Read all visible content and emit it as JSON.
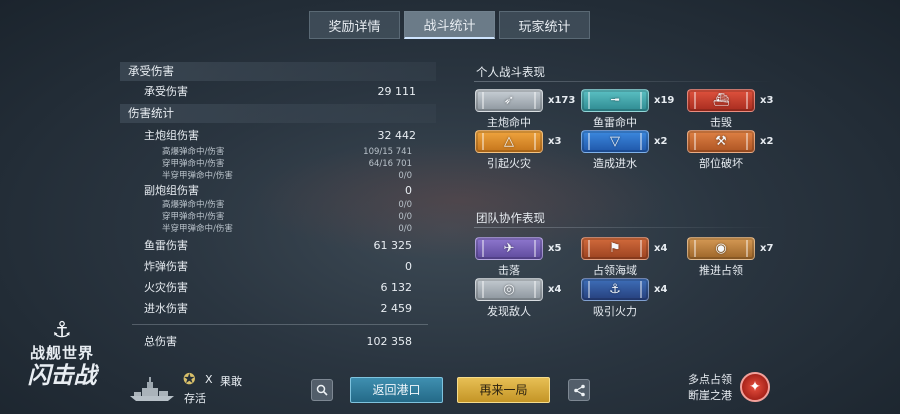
{
  "tabs": [
    {
      "label": "奖励详情",
      "active": false
    },
    {
      "label": "战斗统计",
      "active": true
    },
    {
      "label": "玩家统计",
      "active": false
    }
  ],
  "damage_taken": {
    "header": "承受伤害",
    "rows": [
      {
        "label": "承受伤害",
        "value": "29 111"
      }
    ]
  },
  "damage_stats": {
    "header": "伤害统计",
    "main_battery": {
      "label": "主炮组伤害",
      "value": "32 442"
    },
    "main_sub": [
      {
        "label": "高爆弹命中/伤害",
        "value": "109/15 741"
      },
      {
        "label": "穿甲弹命中/伤害",
        "value": "64/16 701"
      },
      {
        "label": "半穿甲弹命中/伤害",
        "value": "0/0"
      }
    ],
    "secondary": {
      "label": "副炮组伤害",
      "value": "0"
    },
    "secondary_sub": [
      {
        "label": "高爆弹命中/伤害",
        "value": "0/0"
      },
      {
        "label": "穿甲弹命中/伤害",
        "value": "0/0"
      },
      {
        "label": "半穿甲弹命中/伤害",
        "value": "0/0"
      }
    ],
    "others": [
      {
        "label": "鱼雷伤害",
        "value": "61 325"
      },
      {
        "label": "炸弹伤害",
        "value": "0"
      },
      {
        "label": "火灾伤害",
        "value": "6 132"
      },
      {
        "label": "进水伤害",
        "value": "2 459"
      }
    ],
    "total": {
      "label": "总伤害",
      "value": "102 358"
    }
  },
  "personal": {
    "title": "个人战斗表现",
    "medals": [
      {
        "label": "主炮命中",
        "count": "x173",
        "color": "#c9d0d6",
        "icon": "shell-icon"
      },
      {
        "label": "鱼雷命中",
        "count": "x19",
        "color": "#5cc1c4",
        "icon": "torpedo-icon"
      },
      {
        "label": "击毁",
        "count": "x3",
        "color": "#e0533e",
        "icon": "sinking-ship-icon"
      },
      {
        "label": "引起火灾",
        "count": "x3",
        "color": "#f0a53f",
        "icon": "fire-icon"
      },
      {
        "label": "造成进水",
        "count": "x2",
        "color": "#3d8ae0",
        "icon": "flooding-icon"
      },
      {
        "label": "部位破坏",
        "count": "x2",
        "color": "#e08245",
        "icon": "module-break-icon"
      }
    ]
  },
  "team": {
    "title": "团队协作表现",
    "medals": [
      {
        "label": "击落",
        "count": "x5",
        "color": "#8f78cf",
        "icon": "plane-shot-icon"
      },
      {
        "label": "占领海域",
        "count": "x4",
        "color": "#d26b3c",
        "icon": "flag-icon"
      },
      {
        "label": "推进占领",
        "count": "x7",
        "color": "#d69a55",
        "icon": "capture-assist-icon"
      },
      {
        "label": "发现敌人",
        "count": "x4",
        "color": "#c4cbd1",
        "icon": "radar-icon"
      },
      {
        "label": "吸引火力",
        "count": "x4",
        "color": "#3e6fb9",
        "icon": "tank-damage-icon"
      }
    ]
  },
  "logo": {
    "line1": "战舰世界",
    "line2": "闪击战"
  },
  "player": {
    "multiplier": "X",
    "status": "果敢",
    "survival": "存活"
  },
  "buttons": {
    "return_port": "返回港口",
    "play_again": "再来一局"
  },
  "mode": {
    "line1": "多点占领",
    "line2": "断崖之港"
  }
}
